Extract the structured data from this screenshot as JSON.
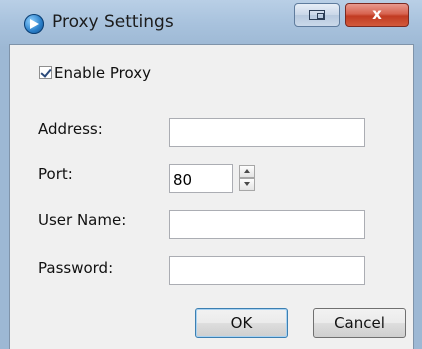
{
  "window": {
    "title": "Proxy Settings",
    "close_glyph": "x",
    "icon": "app-globe-arrow-icon",
    "chrome_color": "#a8c2dd"
  },
  "form": {
    "enable_proxy": {
      "label": "Enable Proxy",
      "checked": true
    },
    "address": {
      "label": "Address:",
      "value": ""
    },
    "port": {
      "label": "Port:",
      "value": "80"
    },
    "user_name": {
      "label": "User Name:",
      "value": ""
    },
    "password": {
      "label": "Password:",
      "value": ""
    }
  },
  "buttons": {
    "ok": "OK",
    "cancel": "Cancel"
  }
}
